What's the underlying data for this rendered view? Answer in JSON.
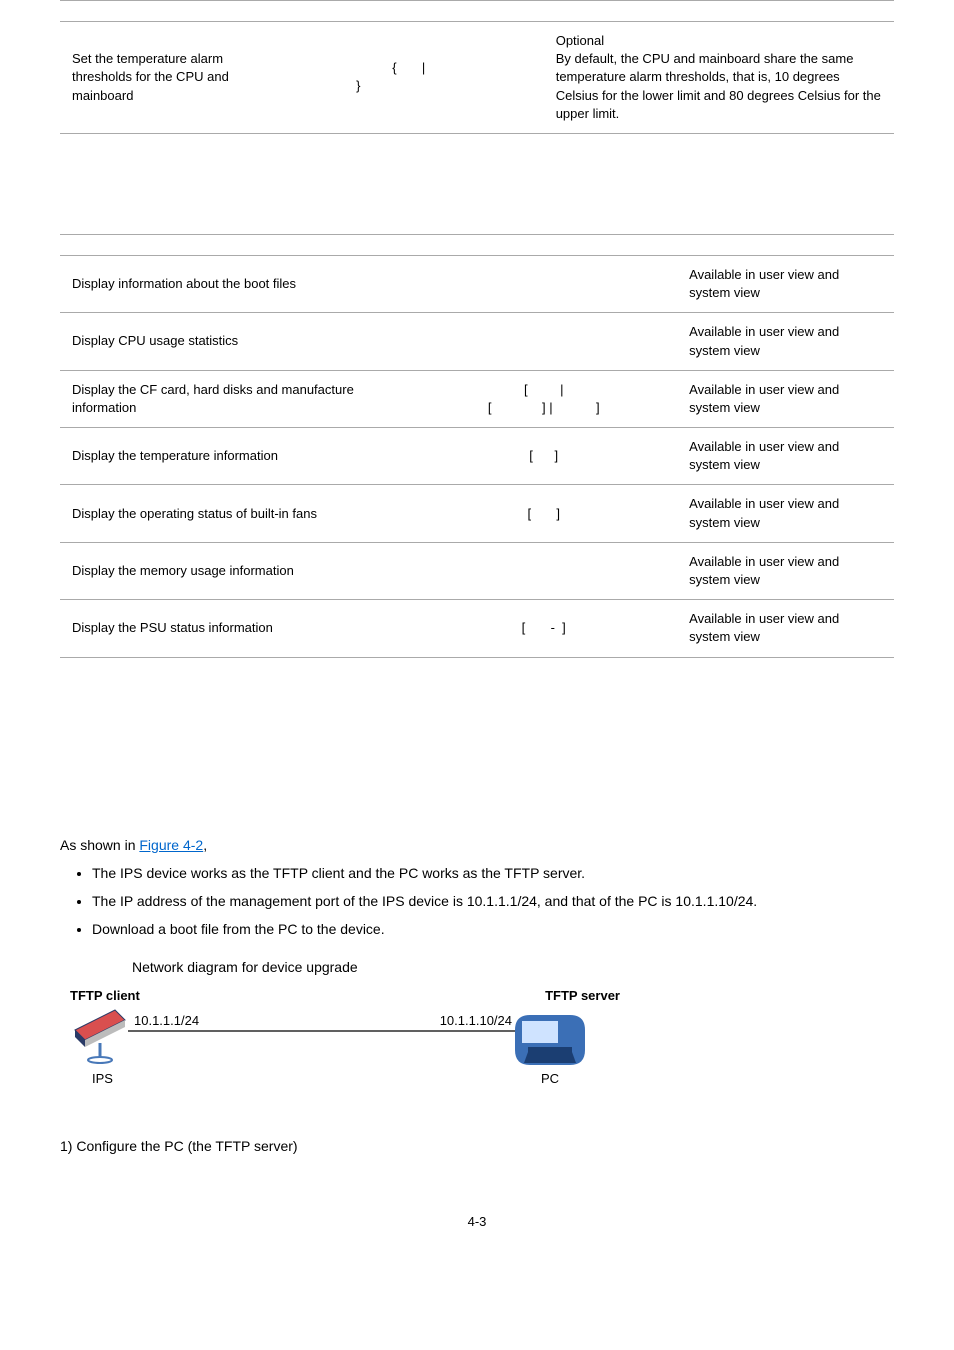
{
  "table1": {
    "rows": [
      {
        "a": "Set the temperature alarm thresholds for the CPU and mainboard",
        "b_left": "{",
        "b_right": "|",
        "b_end": "}",
        "c": "Optional\nBy default, the CPU and mainboard share the same temperature alarm thresholds, that is, 10 degrees Celsius for the lower limit and 80 degrees Celsius for the upper limit."
      }
    ]
  },
  "table2": {
    "rows": [
      {
        "a": "Display information about the boot files",
        "b": "",
        "c": "Available in user view and system view"
      },
      {
        "a": "Display CPU usage statistics",
        "b": "",
        "c": "Available in user view and system view"
      },
      {
        "a": "Display the CF card, hard disks and manufacture information",
        "b": "[         |\n[              ] |            ]",
        "c": "Available in user view and system view"
      },
      {
        "a": "Display the temperature information",
        "b": "[      ]",
        "c": "Available in user view and system view"
      },
      {
        "a": "Display the operating status of built-in fans",
        "b": "[       ]",
        "c": "Available in user view and system view"
      },
      {
        "a": "Display the memory usage information",
        "b": "",
        "c": "Available in user view and system view"
      },
      {
        "a": "Display the PSU status information",
        "b": "[       -  ]",
        "c": "Available in user view and system view"
      }
    ]
  },
  "intro": {
    "line": "As shown in ",
    "link": "Figure 4-2",
    "after": ","
  },
  "bullets": [
    "The IPS device works as the TFTP client and the PC works as the TFTP server.",
    "The IP address of the management port of the IPS device is 10.1.1.1/24, and that of the PC is 10.1.1.10/24.",
    "Download a boot file from the PC to the device."
  ],
  "figure": {
    "caption": "Network diagram for device upgrade",
    "left_title": "TFTP client",
    "left_ip": "10.1.1.1/24",
    "left_label": "IPS",
    "right_title": "TFTP server",
    "right_ip": "10.1.1.10/24",
    "right_label": "PC"
  },
  "step": "1)   Configure the PC (the TFTP server)",
  "page": "4-3"
}
